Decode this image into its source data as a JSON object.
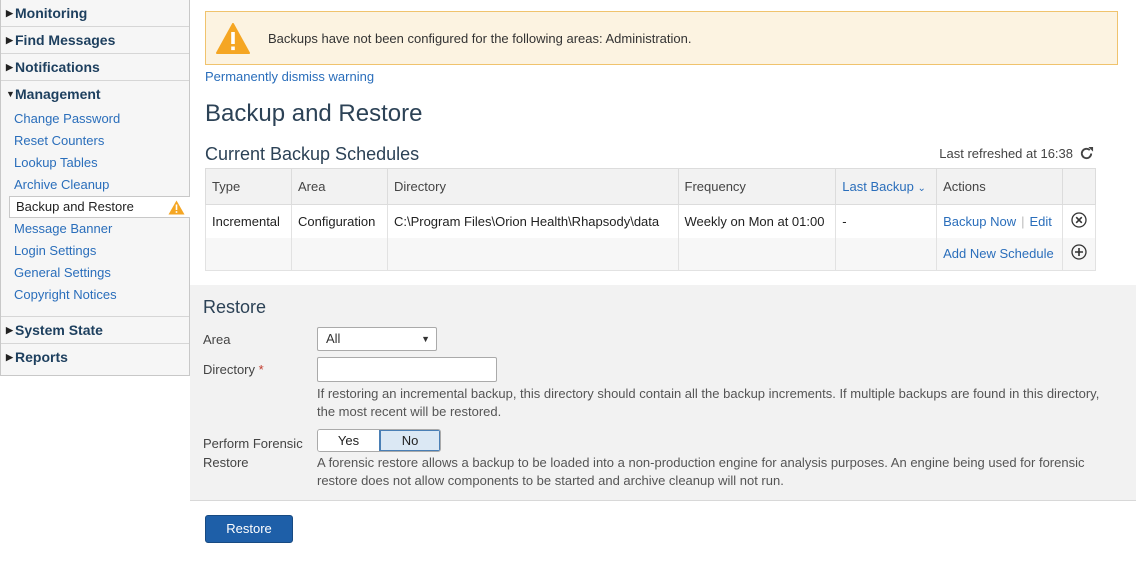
{
  "sidebar": {
    "sections": {
      "monitoring": "Monitoring",
      "find_messages": "Find Messages",
      "notifications": "Notifications",
      "management": "Management",
      "system_state": "System State",
      "reports": "Reports"
    },
    "management_items": [
      "Change Password",
      "Reset Counters",
      "Lookup Tables",
      "Archive Cleanup",
      "Backup and Restore",
      "Message Banner",
      "Login Settings",
      "General Settings",
      "Copyright Notices"
    ]
  },
  "warning": {
    "text": "Backups have not been configured for the following areas: Administration.",
    "dismiss": "Permanently dismiss warning",
    "color": "#f5a623"
  },
  "page": {
    "title": "Backup and Restore",
    "schedules_title": "Current Backup Schedules",
    "last_refreshed": "Last refreshed at 16:38"
  },
  "schedule_table": {
    "headers": [
      "Type",
      "Area",
      "Directory",
      "Frequency",
      "Last Backup",
      "Actions"
    ],
    "rows": [
      {
        "type": "Incremental",
        "area": "Configuration",
        "directory": "C:\\Program Files\\Orion Health\\Rhapsody\\data",
        "frequency": "Weekly on Mon at 01:00",
        "last_backup": "-",
        "backup_now": "Backup Now",
        "edit": "Edit"
      }
    ],
    "add_new": "Add New Schedule"
  },
  "restore": {
    "title": "Restore",
    "area_label": "Area",
    "area_value": "All",
    "directory_label": "Directory",
    "required_mark": "*",
    "directory_value": "",
    "directory_help": "If restoring an incremental backup, this directory should contain all the backup increments. If multiple backups are found in this directory, the most recent will be restored.",
    "forensic_label_1": "Perform Forensic",
    "forensic_label_2": "Restore",
    "yes": "Yes",
    "no": "No",
    "forensic_selected": "No",
    "forensic_help": "A forensic restore allows a backup to be loaded into a non-production engine for analysis purposes. An engine being used for forensic restore does not allow components to be started and archive cleanup will not run.",
    "button": "Restore"
  }
}
